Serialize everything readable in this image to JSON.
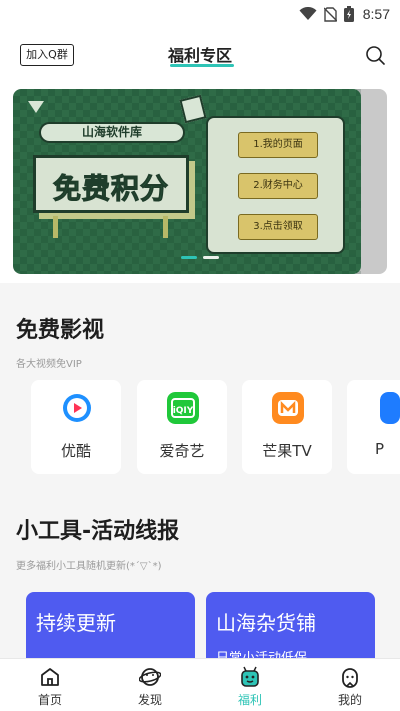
{
  "status_bar": {
    "time": "8:57"
  },
  "header": {
    "join_label": "加入Q群",
    "title": "福利专区"
  },
  "banner": {
    "brand": "山海软件库",
    "headline": "免费积分",
    "steps": [
      "1.我的页面",
      "2.财务中心",
      "3.点击领取"
    ]
  },
  "videos": {
    "title": "免费影视",
    "subtitle": "各大视频免VIP",
    "items": [
      {
        "label": "优酷",
        "icon": "youku-icon",
        "color": "#1e90ff"
      },
      {
        "label": "爱奇艺",
        "icon": "iqiyi-icon",
        "color": "#20c83a"
      },
      {
        "label": "芒果TV",
        "icon": "mangotv-icon",
        "color": "#ff8a1f"
      },
      {
        "label": "P",
        "icon": "pptv-icon",
        "color": "#1e7cff"
      }
    ]
  },
  "tools": {
    "title": "小工具-活动线报",
    "subtitle": "更多福利小工具随机更新(*´▽`*)",
    "cards": [
      {
        "title": "持续更新",
        "sub": ""
      },
      {
        "title": "山海杂货铺",
        "sub": "日常小活动低保"
      }
    ]
  },
  "nav": {
    "items": [
      {
        "label": "首页",
        "icon": "home-icon"
      },
      {
        "label": "发现",
        "icon": "discover-icon"
      },
      {
        "label": "福利",
        "icon": "welfare-icon"
      },
      {
        "label": "我的",
        "icon": "profile-icon"
      }
    ],
    "active_index": 2
  },
  "colors": {
    "accent": "#2ec4b6",
    "tool_card": "#4f5bf0",
    "banner_green": "#2f6b47"
  }
}
